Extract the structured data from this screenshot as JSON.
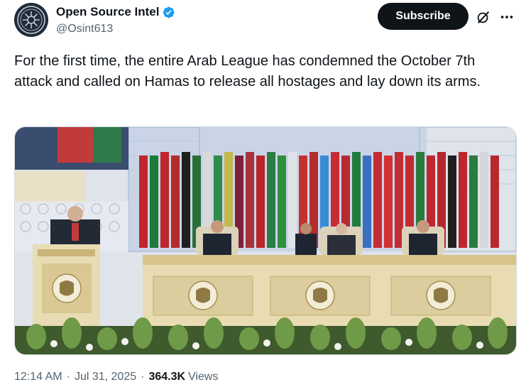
{
  "author": {
    "display_name": "Open Source Intel",
    "handle": "@Osint613",
    "verified_color": "#1d9bf0",
    "avatar_icon": "intel-seal-avatar"
  },
  "actions": {
    "subscribe_label": "Subscribe",
    "grok_icon": "grok-icon",
    "more_icon": "more-options-icon"
  },
  "tweet": {
    "text": "For the first time, the entire Arab League has condemned the October 7th attack and called on Hamas to release all hostages and lay down its arms."
  },
  "media": {
    "description_icon": "arab-league-summit-photo"
  },
  "meta": {
    "time": "12:14 AM",
    "date": "Jul 31, 2025",
    "views_count": "364.3K",
    "views_label": "Views",
    "separator": "·"
  },
  "colors": {
    "text_primary": "#0f1419",
    "text_secondary": "#536471",
    "button_bg": "#0f1419",
    "border": "#cfd9de"
  }
}
